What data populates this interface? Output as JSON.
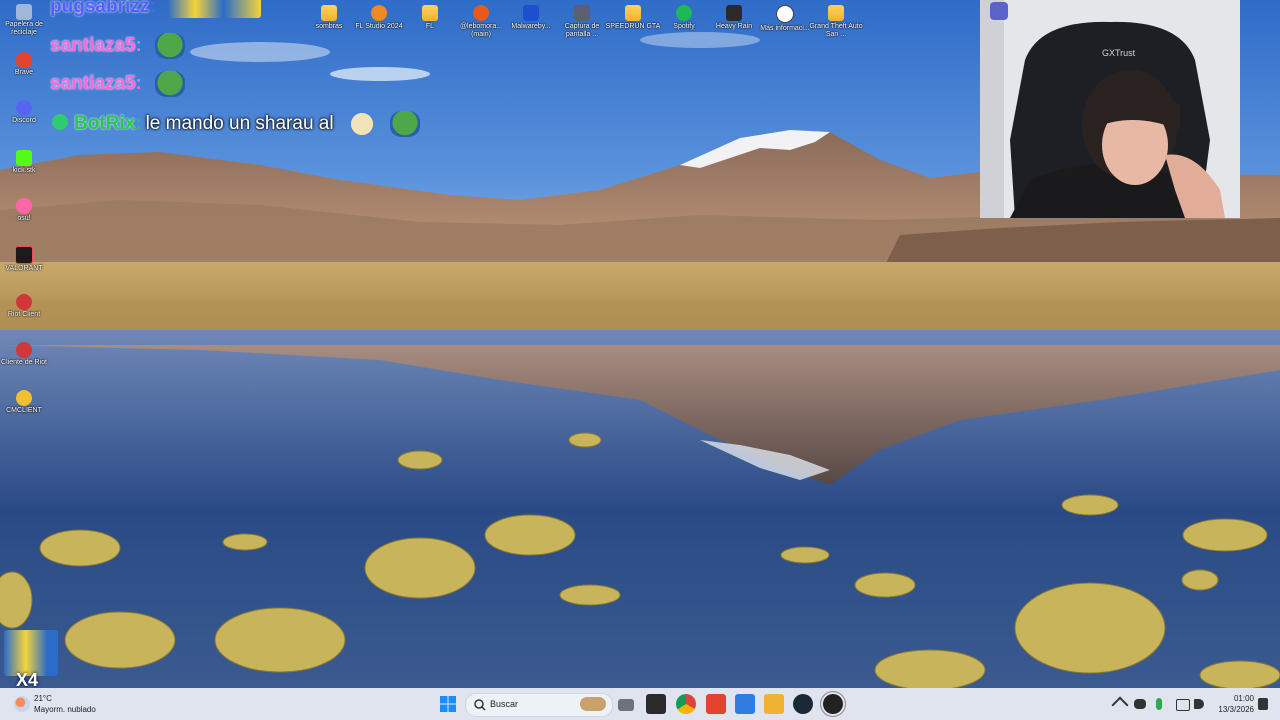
{
  "desktop_icons_left": [
    {
      "label": "Papelera de reciclaje",
      "icon": "recycle-bin-icon",
      "color": "#9fb7d8"
    },
    {
      "label": "Brave",
      "icon": "brave-icon",
      "color": "#e2442f"
    },
    {
      "label": "Discord",
      "icon": "discord-icon",
      "color": "#5865f2"
    },
    {
      "label": "kick.stk",
      "icon": "kick-icon",
      "color": "#53fc18"
    },
    {
      "label": "osu!",
      "icon": "osu-icon",
      "color": "#ff66aa"
    },
    {
      "label": "VALORANT",
      "icon": "valorant-icon",
      "color": "#1a1a1a"
    },
    {
      "label": "Riot Client",
      "icon": "riot-client-icon",
      "color": "#d13639"
    },
    {
      "label": "Cliente de Riot",
      "icon": "riot-client-icon",
      "color": "#d13639"
    },
    {
      "label": "CMCLIENT",
      "icon": "cmclient-icon",
      "color": "#f0c030"
    }
  ],
  "desktop_icons_top": [
    {
      "label": "sombras",
      "icon": "folder-icon"
    },
    {
      "label": "FL Studio 2024",
      "icon": "fl-studio-icon"
    },
    {
      "label": "FL",
      "icon": "folder-icon"
    },
    {
      "label": "@lebomora... (main)",
      "icon": "app-icon"
    },
    {
      "label": "Malwareby...",
      "icon": "malwarebytes-icon"
    },
    {
      "label": "Captura de pantalla ...",
      "icon": "camera-icon"
    },
    {
      "label": "SPEEDRUN GTA",
      "icon": "folder-icon"
    },
    {
      "label": "Spotify",
      "icon": "spotify-icon"
    },
    {
      "label": "Heavy Rain",
      "icon": "game-icon"
    },
    {
      "label": "Más informaci...",
      "icon": "info-icon"
    },
    {
      "label": "Grand Theft Auto San ...",
      "icon": "folder-icon"
    }
  ],
  "chat": [
    {
      "user": "pugsabrizz",
      "text": ""
    },
    {
      "user": "santiaza5",
      "text": ""
    },
    {
      "user": "santiaza5",
      "text": ""
    },
    {
      "user": "BotRix",
      "text": "le mando un sharau al"
    }
  ],
  "chat_colors": {
    "user1": "#5a5cff",
    "user2": "#ff66dd",
    "bot": "#22cc44"
  },
  "taskbar": {
    "weather_temp": "21°C",
    "weather_cond": "Mayorm. nublado",
    "search_placeholder": "Buscar",
    "time": "01:00",
    "date": "13/3/2026"
  },
  "corner_badge": "X4"
}
